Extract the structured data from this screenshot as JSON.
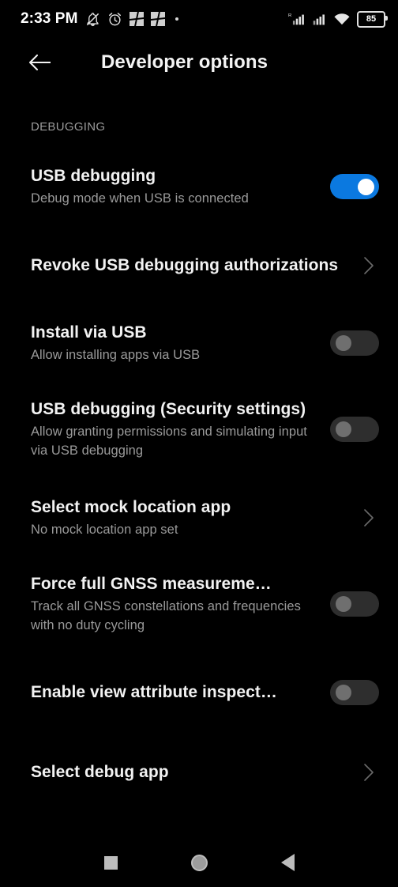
{
  "status_bar": {
    "time": "2:33 PM",
    "battery_level": "85",
    "icons": [
      "notifications-silenced-icon",
      "alarm-icon",
      "app-notification-icon",
      "app-notification-icon",
      "more-notifications-dot-icon"
    ],
    "right_icons": [
      "signal-roaming-icon",
      "signal-icon",
      "wifi-icon",
      "battery-icon"
    ]
  },
  "app_bar": {
    "back_icon": "back-arrow-icon",
    "title": "Developer options"
  },
  "section": {
    "label": "DEBUGGING"
  },
  "rows": [
    {
      "title": "USB debugging",
      "subtitle": "Debug mode when USB is connected",
      "control": "switch",
      "state": "on"
    },
    {
      "title": "Revoke USB debugging authorizations",
      "subtitle": "",
      "control": "chevron",
      "state": ""
    },
    {
      "title": "Install via USB",
      "subtitle": "Allow installing apps via USB",
      "control": "switch",
      "state": "off"
    },
    {
      "title": "USB debugging (Security settings)",
      "subtitle": "Allow granting permissions and simulating input via USB debugging",
      "control": "switch",
      "state": "off"
    },
    {
      "title": "Select mock location app",
      "subtitle": "No mock location app set",
      "control": "chevron",
      "state": ""
    },
    {
      "title": "Force full GNSS measureme…",
      "subtitle": "Track all GNSS constellations and frequencies with no duty cycling",
      "control": "switch",
      "state": "off"
    },
    {
      "title": "Enable view attribute inspect…",
      "subtitle": "",
      "control": "switch",
      "state": "off"
    },
    {
      "title": "Select debug app",
      "subtitle": "",
      "control": "chevron",
      "state": ""
    }
  ],
  "nav_bar": {
    "recents_label": "recents-icon",
    "home_label": "home-icon",
    "back_label": "back-icon"
  },
  "colors": {
    "background": "#000000",
    "accent_on": "#0b79e0",
    "switch_off_track": "#2e2e2e",
    "switch_off_thumb": "#6f6f6f",
    "title_text": "#f2f2f2",
    "subtitle_text": "#9a9a9a"
  }
}
